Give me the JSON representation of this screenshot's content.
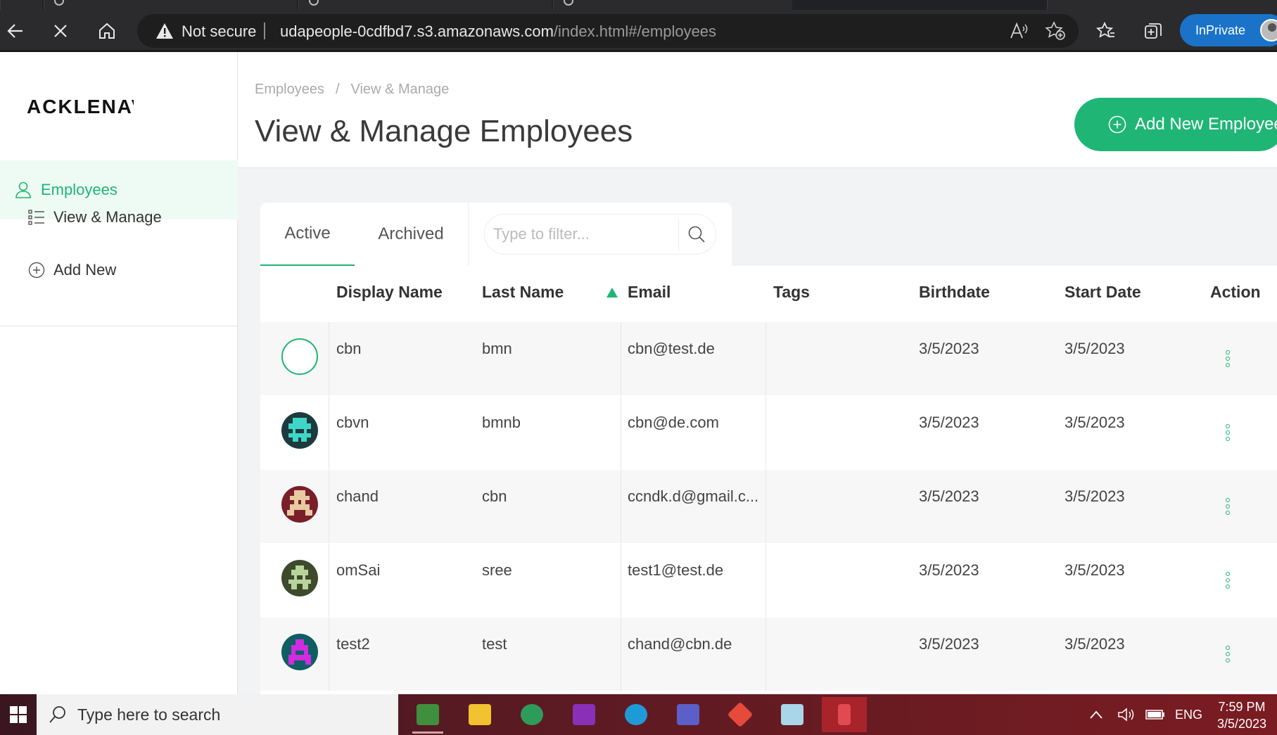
{
  "browser": {
    "security_label": "Not secure",
    "url_host": "udapeople-0cdfbd7.s3.amazonaws.com",
    "url_path": "/index.html#/employees",
    "profile_label": "InPrivate"
  },
  "sidebar": {
    "logo": "ACKLENAVENUE",
    "active_item": "Employees",
    "items": [
      {
        "label": "View & Manage",
        "icon": "list-icon"
      },
      {
        "label": "Add New",
        "icon": "plus-circle-icon"
      }
    ]
  },
  "header": {
    "breadcrumbs": [
      "Employees",
      "View & Manage"
    ],
    "title": "View & Manage Employees",
    "add_button": "Add New Employee"
  },
  "tabs": [
    "Active",
    "Archived"
  ],
  "filter": {
    "placeholder": "Type to filter..."
  },
  "table": {
    "columns": [
      "Display Name",
      "Last Name",
      "Email",
      "Tags",
      "Birthdate",
      "Start Date",
      "Action"
    ],
    "sorted_column": "Email",
    "rows": [
      {
        "display_name": "cbn",
        "last_name": "bmn",
        "email": "cbn@test.de",
        "tags": "",
        "birthdate": "3/5/2023",
        "start_date": "3/5/2023",
        "avatar": "empty"
      },
      {
        "display_name": "cbvn",
        "last_name": "bmnb",
        "email": "cbn@de.com",
        "tags": "",
        "birthdate": "3/5/2023",
        "start_date": "3/5/2023",
        "avatar": "teal"
      },
      {
        "display_name": "chand",
        "last_name": "cbn",
        "email": "ccndk.d@gmail.c...",
        "tags": "",
        "birthdate": "3/5/2023",
        "start_date": "3/5/2023",
        "avatar": "maroon"
      },
      {
        "display_name": "omSai",
        "last_name": "sree",
        "email": "test1@test.de",
        "tags": "",
        "birthdate": "3/5/2023",
        "start_date": "3/5/2023",
        "avatar": "olive"
      },
      {
        "display_name": "test2",
        "last_name": "test",
        "email": "chand@cbn.de",
        "tags": "",
        "birthdate": "3/5/2023",
        "start_date": "3/5/2023",
        "avatar": "magenta"
      }
    ]
  },
  "taskbar": {
    "search_placeholder": "Type here to search",
    "language": "ENG",
    "time": "7:59 PM",
    "date": "3/5/2023"
  },
  "colors": {
    "accent": "#1fb675",
    "inprivate": "#1a73c8"
  }
}
